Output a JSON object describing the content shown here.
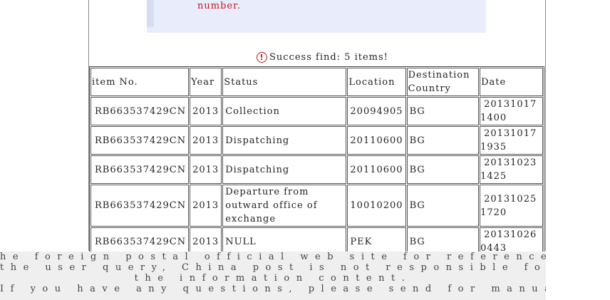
{
  "notice": {
    "text": "number."
  },
  "result": {
    "message": "Success find: 5 items!",
    "icon": "alert-circle-icon"
  },
  "table": {
    "headers": {
      "item_no": "item No.",
      "year": "Year",
      "status": "Status",
      "location": "Location",
      "destination": "Destination Country",
      "date": "Date"
    },
    "rows": [
      {
        "item_no": "RB663537429CN",
        "year": "2013",
        "status": "Collection",
        "location": "20094905",
        "destination": "BG",
        "date_line1": "20131017",
        "date_line2": "1400"
      },
      {
        "item_no": "RB663537429CN",
        "year": "2013",
        "status": "Dispatching",
        "location": "20110600",
        "destination": "BG",
        "date_line1": "20131017",
        "date_line2": "1935"
      },
      {
        "item_no": "RB663537429CN",
        "year": "2013",
        "status": "Dispatching",
        "location": "20110600",
        "destination": "BG",
        "date_line1": "20131023",
        "date_line2": "1425"
      },
      {
        "item_no": "RB663537429CN",
        "year": "2013",
        "status": "Departure from outward office of exchange",
        "location": "10010200",
        "destination": "BG",
        "date_line1": "20131025",
        "date_line2": "1720"
      },
      {
        "item_no": "RB663537429CN",
        "year": "2013",
        "status": "NULL",
        "location": "PEK",
        "destination": "BG",
        "date_line1": "20131026",
        "date_line2": "0443"
      }
    ]
  },
  "footer": {
    "line1": "he foreign postal official web site for reference of",
    "line2": "the user query, China post is not responsible for",
    "line3": "the information content.",
    "line4": "If you have any questions, please send for manual"
  }
}
